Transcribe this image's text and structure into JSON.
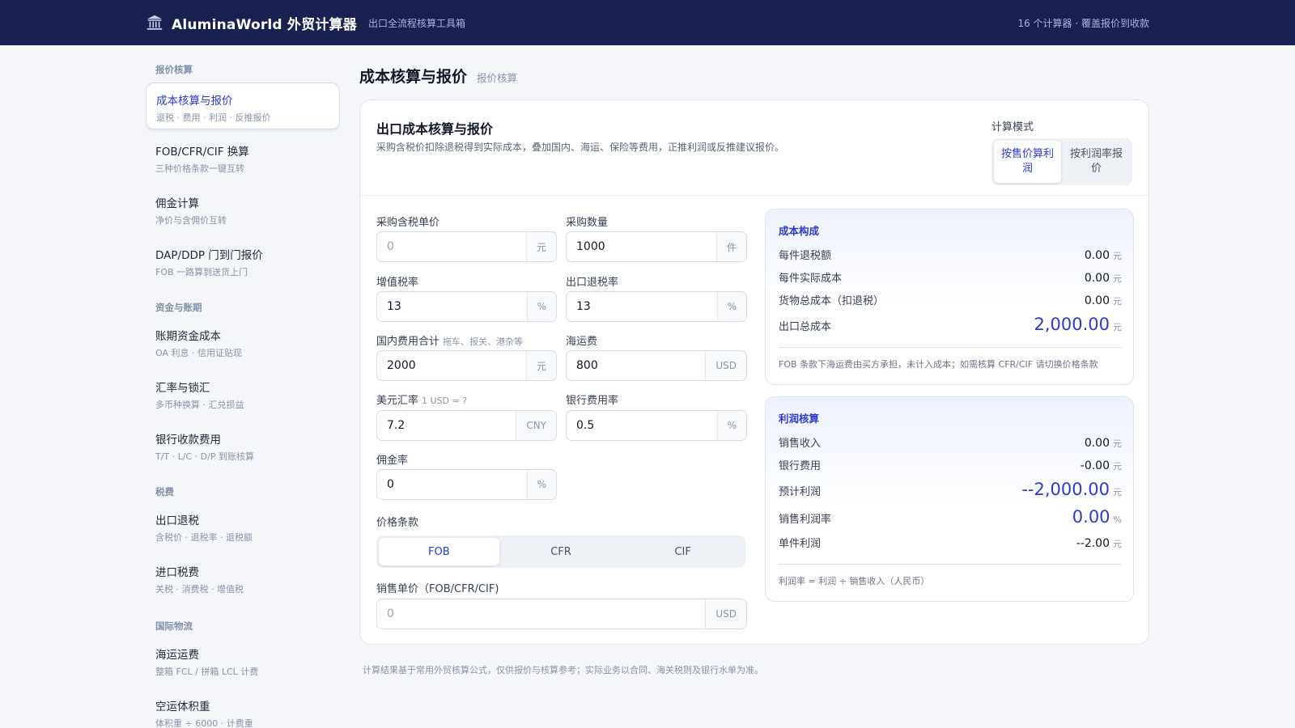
{
  "header": {
    "title": "AluminaWorld 外贸计算器",
    "subtitle": "出口全流程核算工具箱",
    "right_text": "16 个计算器 · 覆盖报价到收款"
  },
  "sidebar": {
    "groups": [
      {
        "title": "报价核算",
        "items": [
          {
            "title": "成本核算与报价",
            "sub": "退税 · 费用 · 利润 · 反推报价"
          },
          {
            "title": "FOB/CFR/CIF 换算",
            "sub": "三种价格条款一键互转"
          },
          {
            "title": "佣金计算",
            "sub": "净价与含佣价互转"
          },
          {
            "title": "DAP/DDP 门到门报价",
            "sub": "FOB 一路算到送货上门"
          }
        ]
      },
      {
        "title": "资金与账期",
        "items": [
          {
            "title": "账期资金成本",
            "sub": "OA 利息 · 信用证贴现"
          },
          {
            "title": "汇率与锁汇",
            "sub": "多币种换算 · 汇兑损益"
          },
          {
            "title": "银行收款费用",
            "sub": "T/T · L/C · D/P 到账核算"
          }
        ]
      },
      {
        "title": "税费",
        "items": [
          {
            "title": "出口退税",
            "sub": "含税价 · 退税率 · 退税额"
          },
          {
            "title": "进口税费",
            "sub": "关税 · 消费税 · 增值税"
          }
        ]
      },
      {
        "title": "国际物流",
        "items": [
          {
            "title": "海运运费",
            "sub": "整箱 FCL / 拼箱 LCL 计费"
          },
          {
            "title": "空运体积重",
            "sub": "体积重 ÷ 6000 · 计费重"
          }
        ]
      }
    ]
  },
  "main": {
    "page_title": "成本核算与报价",
    "breadcrumb": "报价核算",
    "card_title": "出口成本核算与报价",
    "card_desc": "采购含税价扣除退税得到实际成本，叠加国内、海运、保险等费用，正推利润或反推建议报价。",
    "mode_label": "计算模式",
    "modes": [
      "按售价算利润",
      "按利润率报价"
    ],
    "fields": {
      "purchase_price": {
        "label": "采购含税单价",
        "value": "",
        "placeholder": "0",
        "unit": "元"
      },
      "quantity": {
        "label": "采购数量",
        "value": "1000",
        "unit": "件"
      },
      "vat_rate": {
        "label": "增值税率",
        "value": "13",
        "unit": "%"
      },
      "rebate_rate": {
        "label": "出口退税率",
        "value": "13",
        "unit": "%"
      },
      "domestic_fee": {
        "label": "国内费用合计",
        "hint": "拖车、报关、港杂等",
        "value": "2000",
        "unit": "元"
      },
      "freight": {
        "label": "海运费",
        "value": "800",
        "unit": "USD"
      },
      "fx_rate": {
        "label": "美元汇率",
        "hint": "1 USD = ?",
        "value": "7.2",
        "unit": "CNY"
      },
      "bank_fee": {
        "label": "银行费用率",
        "value": "0.5",
        "unit": "%"
      },
      "commission": {
        "label": "佣金率",
        "value": "0",
        "unit": "%"
      },
      "sale_price": {
        "label": "销售单价（FOB/CFR/CIF)",
        "value": "",
        "placeholder": "0",
        "unit": "USD"
      }
    },
    "terms_label": "价格条款",
    "terms": [
      "FOB",
      "CFR",
      "CIF"
    ],
    "cost_panel": {
      "title": "成本构成",
      "rows": [
        {
          "k": "每件退税额",
          "v": "0.00",
          "u": "元"
        },
        {
          "k": "每件实际成本",
          "v": "0.00",
          "u": "元"
        },
        {
          "k": "货物总成本（扣退税）",
          "v": "0.00",
          "u": "元"
        },
        {
          "k": "出口总成本",
          "v": "2,000.00",
          "u": "元"
        }
      ],
      "note": "FOB 条款下海运费由买方承担，未计入成本；如需核算 CFR/CIF 请切换价格条款"
    },
    "profit_panel": {
      "title": "利润核算",
      "rows": [
        {
          "k": "销售收入",
          "v": "0.00",
          "u": "元"
        },
        {
          "k": "银行费用",
          "v": "-0.00",
          "u": "元"
        },
        {
          "k": "预计利润",
          "v": "--2,000.00",
          "u": "元"
        },
        {
          "k": "销售利润率",
          "v": "0.00",
          "u": "%"
        },
        {
          "k": "单件利润",
          "v": "--2.00",
          "u": "元"
        }
      ],
      "note": "利润率 = 利润 ÷ 销售收入（人民币）"
    },
    "footnote": "计算结果基于常用外贸核算公式，仅供报价与核算参考；实际业务以合同、海关税则及银行水单为准。"
  },
  "colors": {
    "header_bg": "#1a2152",
    "accent": "#2b3bd0"
  }
}
